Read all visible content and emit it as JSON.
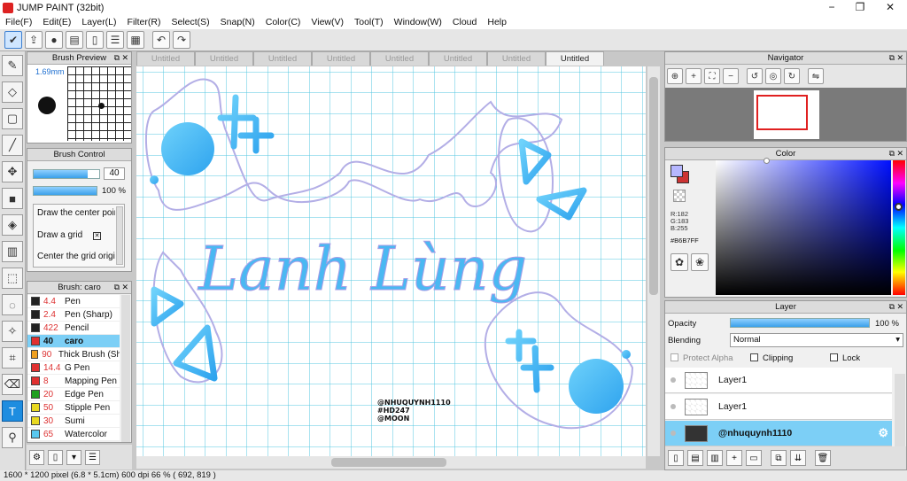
{
  "window": {
    "title": "JUMP PAINT (32bit)",
    "minimize": "−",
    "maximize": "❐",
    "close": "✕"
  },
  "menu": [
    "File(F)",
    "Edit(E)",
    "Layer(L)",
    "Filter(R)",
    "Select(S)",
    "Snap(N)",
    "Color(C)",
    "View(V)",
    "Tool(T)",
    "Window(W)",
    "Cloud",
    "Help"
  ],
  "toolbar": {
    "icons": [
      "select-icon",
      "share-icon",
      "comment-icon",
      "chat-icon",
      "page-icon",
      "page-list-icon",
      "grid-page-icon",
      "undo-icon",
      "redo-icon"
    ]
  },
  "left_tools": [
    "pen-tool-icon",
    "eraser-tool-icon",
    "rectangle-tool-icon",
    "line-tool-icon",
    "move-tool-icon",
    "fill-rect-tool-icon",
    "bucket-tool-icon",
    "gradient-tool-icon",
    "rect-select-icon",
    "lasso-select-icon",
    "magic-wand-icon",
    "pen-select-icon",
    "eraser-select-icon",
    "text-tool-icon",
    "eyedropper-tool-icon"
  ],
  "brush_preview": {
    "title": "Brush Preview",
    "size": "1.69mm"
  },
  "brush_control": {
    "title": "Brush Control",
    "size": "40",
    "size_fill": 0.82,
    "opacity": "100 %",
    "opacity_fill": 1.0,
    "options": [
      "Draw the center point",
      "Draw a grid",
      "Center the grid origin"
    ],
    "grid_checked": "✕"
  },
  "brush_list": {
    "title": "Brush: caro",
    "items": [
      {
        "color": "#222222",
        "size": "4.4",
        "name": "Pen"
      },
      {
        "color": "#222222",
        "size": "2.4",
        "name": "Pen (Sharp)"
      },
      {
        "color": "#222222",
        "size": "422",
        "name": "Pencil"
      },
      {
        "color": "#e03030",
        "size": "40",
        "name": "caro",
        "selected": true
      },
      {
        "color": "#f0a020",
        "size": "90",
        "name": "Thick Brush (Sharp)"
      },
      {
        "color": "#e03030",
        "size": "14.4",
        "name": "G Pen"
      },
      {
        "color": "#e03030",
        "size": "8",
        "name": "Mapping Pen"
      },
      {
        "color": "#20a020",
        "size": "20",
        "name": "Edge Pen"
      },
      {
        "color": "#e8d820",
        "size": "50",
        "name": "Stipple Pen"
      },
      {
        "color": "#e8d820",
        "size": "30",
        "name": "Sumi"
      },
      {
        "color": "#5ac8f0",
        "size": "65",
        "name": "Watercolor"
      }
    ]
  },
  "tabs": [
    "Untitled",
    "Untitled",
    "Untitled",
    "Untitled",
    "Untitled",
    "Untitled",
    "Untitled",
    "Untitled"
  ],
  "canvas": {
    "title_text": "Lanh Lùng",
    "credit": [
      "@NHUQUYNH1110",
      "#HD247",
      "@MOON"
    ],
    "ink_color": "#4ab8f2",
    "outline_color": "#b3aee6",
    "grid_color": "#54c7e0"
  },
  "status": {
    "text": "1600 * 1200 pixel   (6.8 * 5.1cm)   600 dpi   66 %   ( 692, 819 )"
  },
  "navigator": {
    "title": "Navigator"
  },
  "color": {
    "title": "Color",
    "r": "R:182",
    "g": "G:183",
    "b": "B:255",
    "hex": "#B6B7FF",
    "main": "#b6b7ff",
    "sub": "#cc3333"
  },
  "layer": {
    "title": "Layer",
    "opacity_label": "Opacity",
    "opacity": "100 %",
    "blending_label": "Blending",
    "blending": "Normal",
    "protect_alpha": "Protect Alpha",
    "clipping": "Clipping",
    "lock": "Lock",
    "layers": [
      {
        "name": "Layer1"
      },
      {
        "name": "Layer1"
      },
      {
        "name": "@nhuquynh1110",
        "selected": true
      }
    ]
  }
}
